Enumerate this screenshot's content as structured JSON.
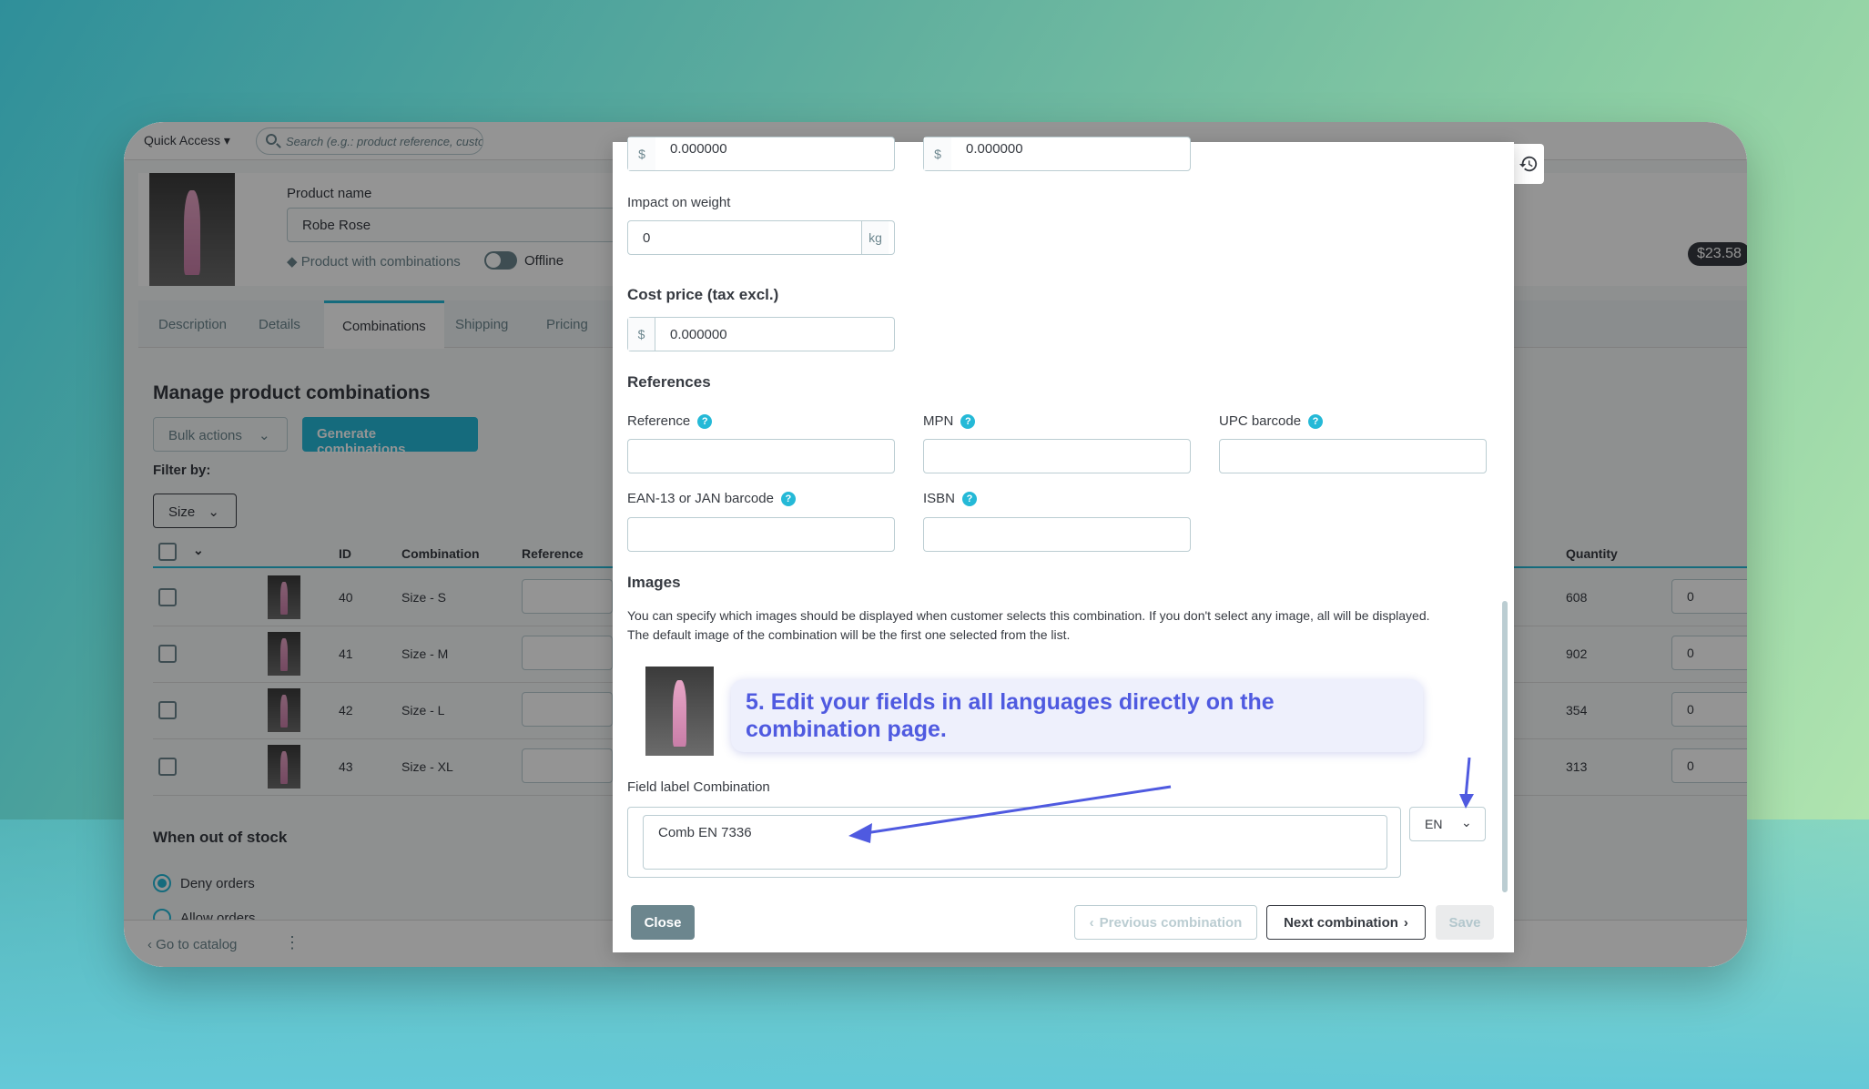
{
  "app": {
    "quick_access": "Quick Access ▾",
    "search_placeholder": "Search (e.g.: product reference, custon",
    "product_name_label": "Product name",
    "product_name_value": "Robe Rose",
    "product_type": "Product with combinations",
    "status": "Offline",
    "price_badge": "$23.58",
    "tabs": [
      "Description",
      "Details",
      "Combinations",
      "Shipping",
      "Pricing"
    ],
    "page_title": "Manage product combinations",
    "bulk_actions": "Bulk actions",
    "generate_button": "Generate combinations",
    "filter_by": "Filter by:",
    "filter_size": "Size",
    "columns": {
      "id": "ID",
      "combination": "Combination",
      "reference": "Reference",
      "quantity": "Quantity"
    },
    "rows": [
      {
        "id": "40",
        "combination": "Size - S",
        "quantity": "608",
        "qty_input": "0"
      },
      {
        "id": "41",
        "combination": "Size - M",
        "quantity": "902",
        "qty_input": "0"
      },
      {
        "id": "42",
        "combination": "Size - L",
        "quantity": "354",
        "qty_input": "0"
      },
      {
        "id": "43",
        "combination": "Size - XL",
        "quantity": "313",
        "qty_input": "0"
      }
    ],
    "out_of_stock_title": "When out of stock",
    "deny_orders": "Deny orders",
    "allow_orders": "Allow orders",
    "go_to_catalog": "Go to catalog"
  },
  "modal": {
    "top_price_1": "0.000000",
    "top_price_2": "0.000000",
    "currency": "$",
    "impact_weight_label": "Impact on weight",
    "impact_weight_value": "0",
    "weight_unit": "kg",
    "cost_price_title": "Cost price (tax excl.)",
    "cost_price_value": "0.000000",
    "references_title": "References",
    "reference_label": "Reference",
    "mpn_label": "MPN",
    "upc_label": "UPC barcode",
    "ean_label": "EAN-13 or JAN barcode",
    "isbn_label": "ISBN",
    "help": "?",
    "images_title": "Images",
    "images_desc_1": "You can specify which images should be displayed when customer selects this combination. If you don't select any image, all will be displayed.",
    "images_desc_2": "The default image of the combination will be the first one selected from the list.",
    "callout": "5. Edit your fields in all languages directly on the combination page.",
    "field_label": "Field label Combination",
    "field_value": "Comb EN 7336",
    "language": "EN",
    "close": "Close",
    "previous": "Previous combination",
    "next": "Next combination",
    "save": "Save"
  },
  "colors": {
    "accent": "#25b9d7",
    "callout_text": "#4f5ae0",
    "arrow": "#4f5ae0"
  },
  "icons": [
    "search-icon",
    "chevron-down-icon",
    "history-icon",
    "chevron-left-icon",
    "chevron-right-icon",
    "help-icon",
    "kebab-menu-icon",
    "layers-icon"
  ]
}
